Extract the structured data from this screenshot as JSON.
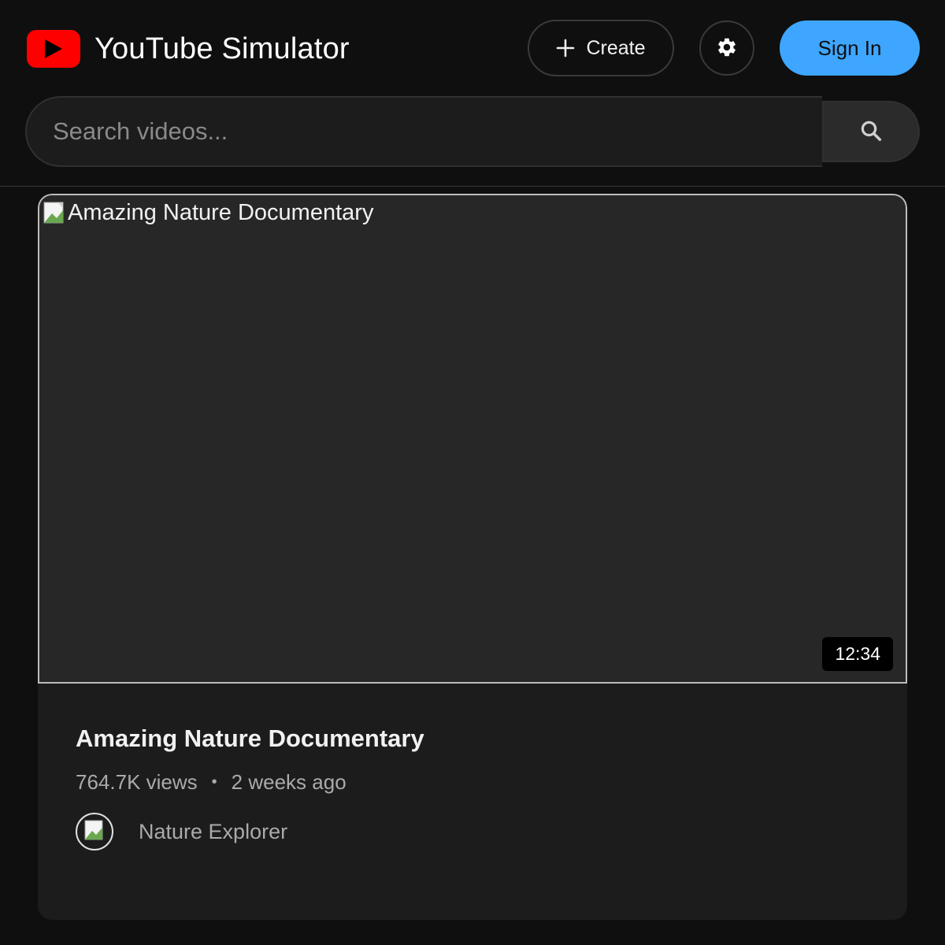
{
  "header": {
    "app_title": "YouTube Simulator",
    "create_label": "Create",
    "signin_label": "Sign In",
    "logo_icon": "play-icon",
    "settings_icon": "gear-icon"
  },
  "search": {
    "placeholder": "Search videos...",
    "value": "",
    "icon": "search-icon"
  },
  "video": {
    "thumbnail_alt": "Amazing Nature Documentary",
    "duration": "12:34",
    "title": "Amazing Nature Documentary",
    "views": "764.7K views",
    "separator": "•",
    "uploaded": "2 weeks ago",
    "channel": "Nature Explorer"
  },
  "colors": {
    "background": "#0f0f0f",
    "accent": "#3ea6ff",
    "brand": "#ff0000",
    "card": "#1c1c1c"
  }
}
